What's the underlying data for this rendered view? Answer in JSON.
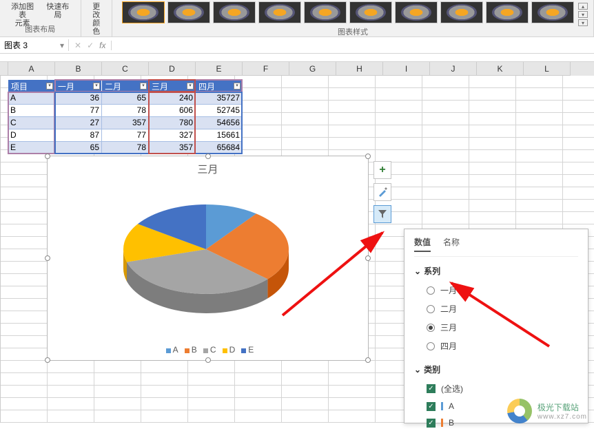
{
  "ribbon": {
    "group1": {
      "btn1": "添加图表\n元素",
      "btn2": "快速布局",
      "label": "图表布局"
    },
    "group2": {
      "btn1": "更改\n颜色"
    },
    "styles_label": "图表样式"
  },
  "name_box": "图表 3",
  "columns": [
    "A",
    "B",
    "C",
    "D",
    "E",
    "F",
    "G",
    "H",
    "I",
    "J",
    "K",
    "L"
  ],
  "table": {
    "headers": [
      "项目",
      "一月",
      "二月",
      "三月",
      "四月"
    ],
    "rows": [
      {
        "label": "A",
        "v": [
          36,
          65,
          240,
          35727
        ]
      },
      {
        "label": "B",
        "v": [
          77,
          78,
          606,
          52745
        ]
      },
      {
        "label": "C",
        "v": [
          27,
          357,
          780,
          54656
        ]
      },
      {
        "label": "D",
        "v": [
          87,
          77,
          327,
          15661
        ]
      },
      {
        "label": "E",
        "v": [
          65,
          78,
          357,
          65684
        ]
      }
    ]
  },
  "chart_data": {
    "type": "pie",
    "title": "三月",
    "categories": [
      "A",
      "B",
      "C",
      "D",
      "E"
    ],
    "values": [
      240,
      606,
      780,
      327,
      357
    ],
    "colors": [
      "#5B9BD5",
      "#ED7D31",
      "#A5A5A5",
      "#FFC000",
      "#4472C4"
    ]
  },
  "filter_panel": {
    "tabs": {
      "values": "数值",
      "names": "名称"
    },
    "series_label": "系列",
    "series": [
      "一月",
      "二月",
      "三月",
      "四月"
    ],
    "series_selected": "三月",
    "category_label": "类别",
    "select_all": "(全选)",
    "categories": [
      {
        "label": "A",
        "color": "#5B9BD5"
      },
      {
        "label": "B",
        "color": "#ED7D31"
      }
    ]
  },
  "watermark": {
    "name": "极光下载站",
    "url": "www.xz7.com"
  }
}
